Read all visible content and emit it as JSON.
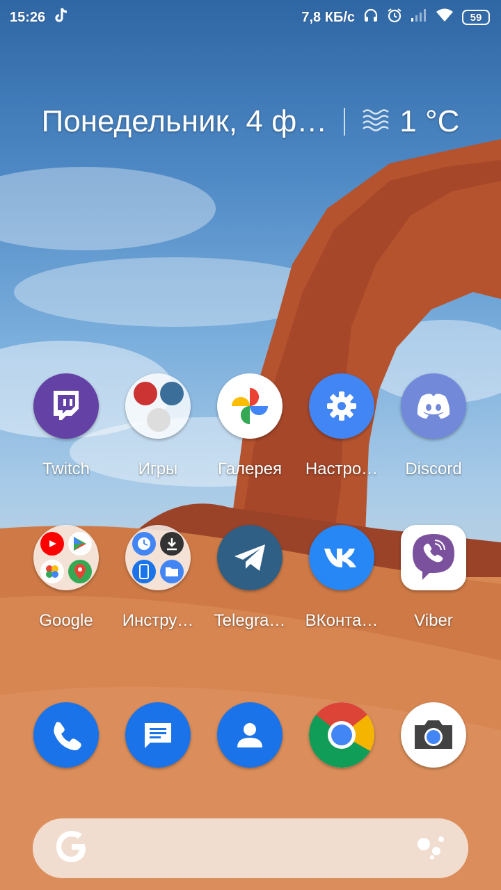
{
  "status_bar": {
    "time": "15:26",
    "net_speed": "7,8 КБ/с",
    "battery": "59"
  },
  "glance": {
    "date": "Понедельник, 4 ф…",
    "temperature": "1 °C",
    "weather_icon": "fog-icon"
  },
  "apps_row1": [
    {
      "label": "Twitch",
      "icon": "twitch-icon",
      "color": "#6441a5"
    },
    {
      "label": "Игры",
      "icon": "games-folder-icon"
    },
    {
      "label": "Галерея",
      "icon": "google-photos-icon"
    },
    {
      "label": "Настро…",
      "icon": "settings-icon",
      "color": "#4285f4"
    },
    {
      "label": "Discord",
      "icon": "discord-icon",
      "color": "#7289da"
    }
  ],
  "apps_row2": [
    {
      "label": "Google",
      "icon": "google-folder-icon"
    },
    {
      "label": "Инстру…",
      "icon": "tools-folder-icon"
    },
    {
      "label": "Telegra…",
      "icon": "telegram-icon",
      "color": "#2f5f84"
    },
    {
      "label": "ВКонта…",
      "icon": "vk-icon",
      "color": "#2787f5"
    },
    {
      "label": "Viber",
      "icon": "viber-icon",
      "color": "#7b519d"
    }
  ],
  "dock": [
    {
      "icon": "phone-icon",
      "color": "#1a73e8"
    },
    {
      "icon": "messages-icon",
      "color": "#1a73e8"
    },
    {
      "icon": "contacts-icon",
      "color": "#1a73e8"
    },
    {
      "icon": "chrome-icon"
    },
    {
      "icon": "camera-icon"
    }
  ],
  "search": {
    "logo": "G"
  }
}
